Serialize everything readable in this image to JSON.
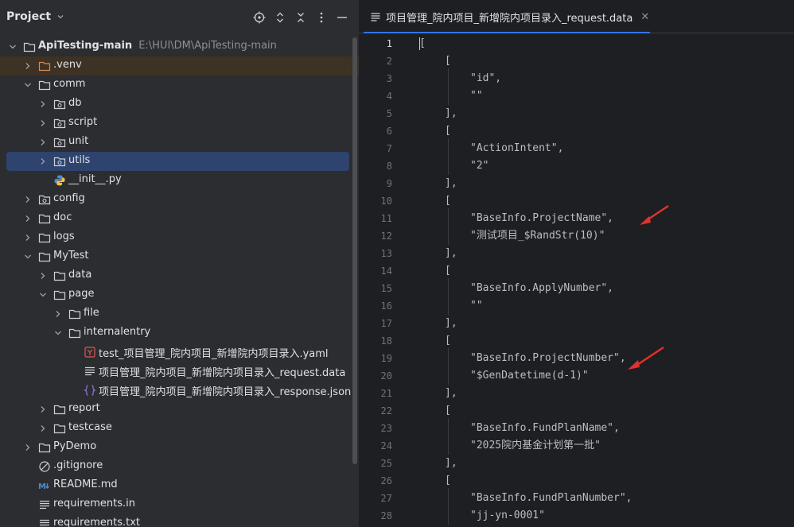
{
  "panel": {
    "title": "Project",
    "toolbar_icons": [
      "locate-icon",
      "expand-collapse-icon",
      "collapse-all-icon",
      "more-icon",
      "minimize-icon"
    ]
  },
  "tree": [
    {
      "label": "ApiTesting-main",
      "path": "E:\\HUI\\DM\\ApiTesting-main",
      "type": "folder",
      "level": 0,
      "expanded": true
    },
    {
      "label": ".venv",
      "type": "folder-excluded",
      "level": 1,
      "expanded": false
    },
    {
      "label": "comm",
      "type": "folder",
      "level": 1,
      "expanded": true
    },
    {
      "label": "db",
      "type": "package",
      "level": 2,
      "expanded": false
    },
    {
      "label": "script",
      "type": "package",
      "level": 2,
      "expanded": false
    },
    {
      "label": "unit",
      "type": "package",
      "level": 2,
      "expanded": false
    },
    {
      "label": "utils",
      "type": "package",
      "level": 2,
      "expanded": false,
      "selected": true
    },
    {
      "label": "__init__.py",
      "type": "python",
      "level": 2
    },
    {
      "label": "config",
      "type": "package",
      "level": 1,
      "expanded": false
    },
    {
      "label": "doc",
      "type": "folder",
      "level": 1,
      "expanded": false
    },
    {
      "label": "logs",
      "type": "folder",
      "level": 1,
      "expanded": false
    },
    {
      "label": "MyTest",
      "type": "folder",
      "level": 1,
      "expanded": true
    },
    {
      "label": "data",
      "type": "folder",
      "level": 2,
      "expanded": false
    },
    {
      "label": "page",
      "type": "folder",
      "level": 2,
      "expanded": true
    },
    {
      "label": "file",
      "type": "folder",
      "level": 3,
      "expanded": false
    },
    {
      "label": "internalentry",
      "type": "folder",
      "level": 3,
      "expanded": true
    },
    {
      "label": "test_项目管理_院内项目_新增院内项目录入.yaml",
      "type": "yaml",
      "level": 4
    },
    {
      "label": "项目管理_院内项目_新增院内项目录入_request.data",
      "type": "text",
      "level": 4
    },
    {
      "label": "项目管理_院内项目_新增院内项目录入_response.json",
      "type": "json",
      "level": 4
    },
    {
      "label": "report",
      "type": "folder",
      "level": 2,
      "expanded": false
    },
    {
      "label": "testcase",
      "type": "folder",
      "level": 2,
      "expanded": false
    },
    {
      "label": "PyDemo",
      "type": "folder",
      "level": 1,
      "expanded": false
    },
    {
      "label": ".gitignore",
      "type": "gitignore",
      "level": 1
    },
    {
      "label": "README.md",
      "type": "markdown",
      "level": 1
    },
    {
      "label": "requirements.in",
      "type": "text",
      "level": 1
    },
    {
      "label": "requirements.txt",
      "type": "text",
      "level": 1
    }
  ],
  "editor": {
    "tab_title": "项目管理_院内项目_新增院内项目录入_request.data",
    "active_line": 1,
    "lines": [
      {
        "n": "1",
        "indent": 0,
        "text": "["
      },
      {
        "n": "2",
        "indent": 1,
        "text": "["
      },
      {
        "n": "3",
        "indent": 2,
        "text": "\"id\","
      },
      {
        "n": "4",
        "indent": 2,
        "text": "\"\""
      },
      {
        "n": "5",
        "indent": 1,
        "text": "],"
      },
      {
        "n": "6",
        "indent": 1,
        "text": "["
      },
      {
        "n": "7",
        "indent": 2,
        "text": "\"ActionIntent\","
      },
      {
        "n": "8",
        "indent": 2,
        "text": "\"2\""
      },
      {
        "n": "9",
        "indent": 1,
        "text": "],"
      },
      {
        "n": "10",
        "indent": 1,
        "text": "["
      },
      {
        "n": "11",
        "indent": 2,
        "text": "\"BaseInfo.ProjectName\","
      },
      {
        "n": "12",
        "indent": 2,
        "text": "\"测试项目_$RandStr(10)\""
      },
      {
        "n": "13",
        "indent": 1,
        "text": "],"
      },
      {
        "n": "14",
        "indent": 1,
        "text": "["
      },
      {
        "n": "15",
        "indent": 2,
        "text": "\"BaseInfo.ApplyNumber\","
      },
      {
        "n": "16",
        "indent": 2,
        "text": "\"\""
      },
      {
        "n": "17",
        "indent": 1,
        "text": "],"
      },
      {
        "n": "18",
        "indent": 1,
        "text": "["
      },
      {
        "n": "19",
        "indent": 2,
        "text": "\"BaseInfo.ProjectNumber\","
      },
      {
        "n": "20",
        "indent": 2,
        "text": "\"$GenDatetime(d-1)\""
      },
      {
        "n": "21",
        "indent": 1,
        "text": "],"
      },
      {
        "n": "22",
        "indent": 1,
        "text": "["
      },
      {
        "n": "23",
        "indent": 2,
        "text": "\"BaseInfo.FundPlanName\","
      },
      {
        "n": "24",
        "indent": 2,
        "text": "\"2025院内基金计划第一批\""
      },
      {
        "n": "25",
        "indent": 1,
        "text": "],"
      },
      {
        "n": "26",
        "indent": 1,
        "text": "["
      },
      {
        "n": "27",
        "indent": 2,
        "text": "\"BaseInfo.FundPlanNumber\","
      },
      {
        "n": "28",
        "indent": 2,
        "text": "\"jj-yn-0001\""
      }
    ]
  },
  "annotations": {
    "arrow_color": "#e0322f",
    "arrow_lines": [
      "11",
      "19"
    ]
  },
  "colors": {
    "panel_bg": "#2b2d30",
    "editor_bg": "#1e1f22",
    "selection": "#2e436e",
    "excluded_highlight": "#3d3223",
    "accent": "#3574f0"
  }
}
